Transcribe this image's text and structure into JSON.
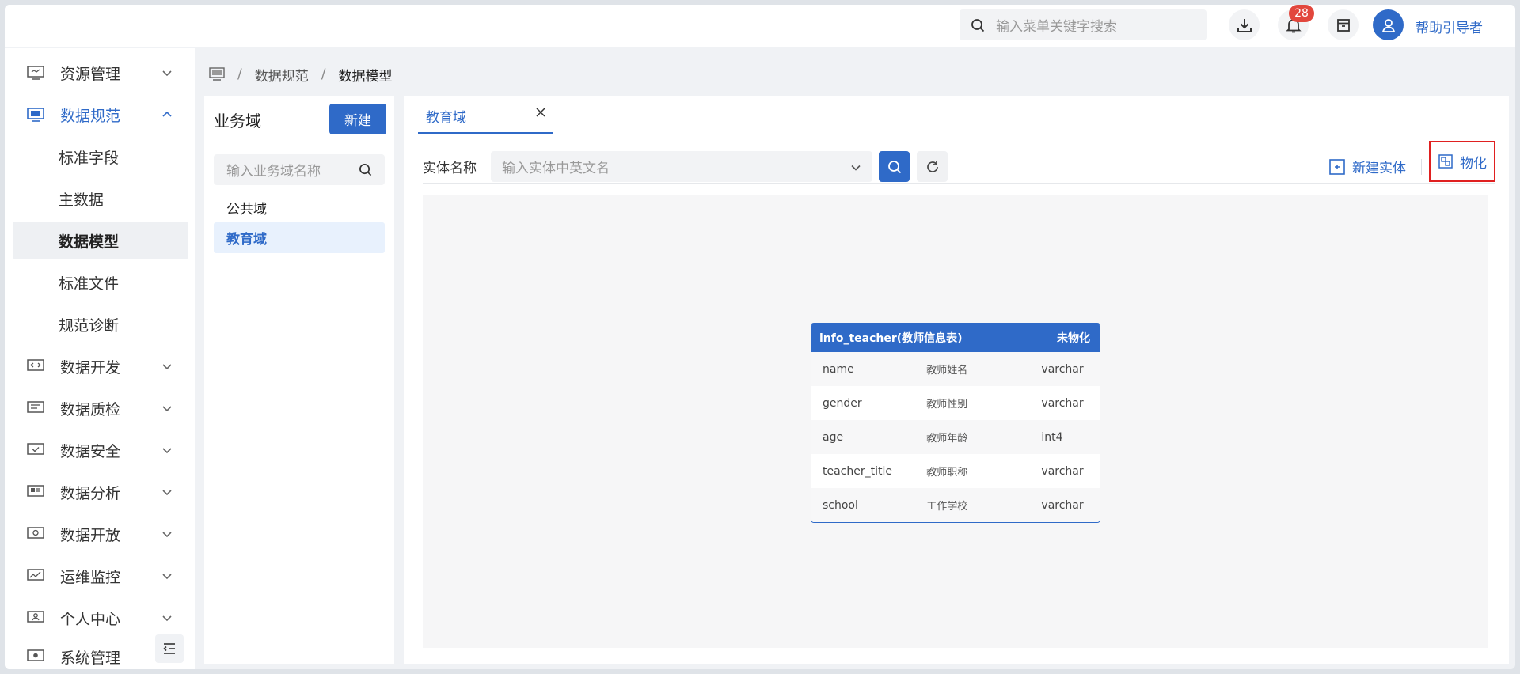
{
  "topbar": {
    "search_placeholder": "输入菜单关键字搜索",
    "notification_count": "28",
    "username": "帮助引导者"
  },
  "sidebar": {
    "items": [
      {
        "label": "资源管理",
        "icon": "resource-icon",
        "expanded": false
      },
      {
        "label": "数据规范",
        "icon": "spec-icon",
        "expanded": true
      },
      {
        "label": "数据开发",
        "icon": "code-icon",
        "expanded": false
      },
      {
        "label": "数据质检",
        "icon": "quality-icon",
        "expanded": false
      },
      {
        "label": "数据安全",
        "icon": "security-icon",
        "expanded": false
      },
      {
        "label": "数据分析",
        "icon": "analysis-icon",
        "expanded": false
      },
      {
        "label": "数据开放",
        "icon": "open-icon",
        "expanded": false
      },
      {
        "label": "运维监控",
        "icon": "monitor-icon",
        "expanded": false
      },
      {
        "label": "个人中心",
        "icon": "user-center-icon",
        "expanded": false
      },
      {
        "label": "系统管理",
        "icon": "system-icon",
        "expanded": false
      }
    ],
    "sub_items": [
      "标准字段",
      "主数据",
      "数据模型",
      "标准文件",
      "规范诊断"
    ],
    "active_sub": "数据模型"
  },
  "breadcrumb": {
    "items": [
      "数据规范",
      "数据模型"
    ]
  },
  "domain_panel": {
    "title": "业务域",
    "new_label": "新建",
    "search_placeholder": "输入业务域名称",
    "items": [
      "公共域",
      "教育域"
    ],
    "active": "教育域"
  },
  "main": {
    "tab_label": "教育域",
    "filter_label": "实体名称",
    "filter_placeholder": "输入实体中英文名",
    "new_entity_label": "新建实体",
    "materialize_label": "物化"
  },
  "entity": {
    "title": "info_teacher(教师信息表)",
    "status": "未物化",
    "fields": [
      {
        "name": "name",
        "label": "教师姓名",
        "type": "varchar"
      },
      {
        "name": "gender",
        "label": "教师性别",
        "type": "varchar"
      },
      {
        "name": "age",
        "label": "教师年龄",
        "type": "int4"
      },
      {
        "name": "teacher_title",
        "label": "教师职称",
        "type": "varchar"
      },
      {
        "name": "school",
        "label": "工作学校",
        "type": "varchar"
      }
    ]
  },
  "colors": {
    "primary": "#2f6ac8",
    "badge": "#e2473d",
    "highlight_border": "#e02020"
  }
}
